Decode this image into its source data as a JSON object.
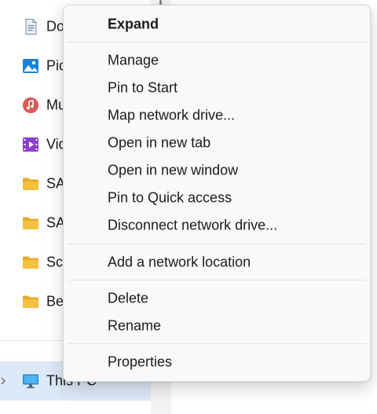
{
  "sidebar": {
    "items": [
      {
        "label": "Do",
        "icon": "documents-icon"
      },
      {
        "label": "Pic",
        "icon": "pictures-icon"
      },
      {
        "label": "Mu",
        "icon": "music-icon"
      },
      {
        "label": "Vid",
        "icon": "videos-icon"
      },
      {
        "label": "SA",
        "icon": "folder-icon"
      },
      {
        "label": "SA",
        "icon": "folder-icon"
      },
      {
        "label": "Sc",
        "icon": "folder-icon"
      },
      {
        "label": "Be",
        "icon": "folder-icon"
      }
    ],
    "this_pc": {
      "label": "This PC",
      "icon": "monitor-icon"
    }
  },
  "context_menu": {
    "expand": "Expand",
    "manage": "Manage",
    "pin_to_start": "Pin to Start",
    "map_network_drive": "Map network drive...",
    "open_in_new_tab": "Open in new tab",
    "open_in_new_window": "Open in new window",
    "pin_to_quick_access": "Pin to Quick access",
    "disconnect_network_drive": "Disconnect network drive...",
    "add_network_location": "Add a network location",
    "delete": "Delete",
    "rename": "Rename",
    "properties": "Properties"
  },
  "colors": {
    "selection": "#dde9f8",
    "menu_background": "#f9f9f9",
    "folder": "#f4c13d",
    "pictures": "#1a82d8",
    "music": "#e8663a",
    "videos": "#8a3fd1"
  }
}
